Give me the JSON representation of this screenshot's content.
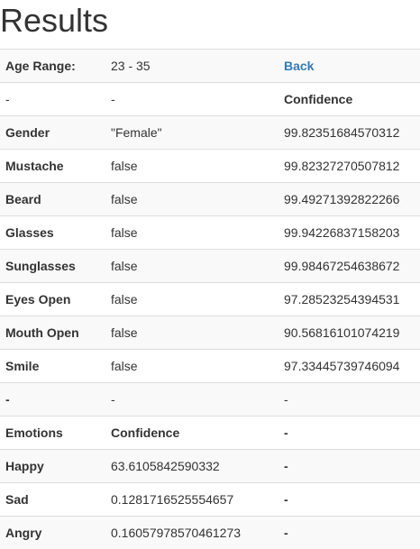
{
  "page_title": "Results",
  "age": {
    "label": "Age Range:",
    "value": "23 - 35",
    "back_link": "Back"
  },
  "attributes_header": {
    "c1": "-",
    "c2": "-",
    "c3": "Confidence"
  },
  "attributes": [
    {
      "name": "Gender",
      "value": "\"Female\"",
      "confidence": "99.82351684570312"
    },
    {
      "name": "Mustache",
      "value": "false",
      "confidence": "99.82327270507812"
    },
    {
      "name": "Beard",
      "value": "false",
      "confidence": "99.49271392822266"
    },
    {
      "name": "Glasses",
      "value": "false",
      "confidence": "99.94226837158203"
    },
    {
      "name": "Sunglasses",
      "value": "false",
      "confidence": "99.98467254638672"
    },
    {
      "name": "Eyes Open",
      "value": "false",
      "confidence": "97.28523254394531"
    },
    {
      "name": "Mouth Open",
      "value": "false",
      "confidence": "90.56816101074219"
    },
    {
      "name": "Smile",
      "value": "false",
      "confidence": "97.33445739746094"
    }
  ],
  "separator": {
    "c1": "-",
    "c2": "-",
    "c3": "-"
  },
  "emotions_header": {
    "c1": "Emotions",
    "c2": "Confidence",
    "c3": "-"
  },
  "emotions": [
    {
      "name": "Happy",
      "confidence": "63.6105842590332",
      "extra": "-"
    },
    {
      "name": "Sad",
      "confidence": "0.1281716525554657",
      "extra": "-"
    },
    {
      "name": "Angry",
      "confidence": "0.16057978570461273",
      "extra": "-"
    }
  ]
}
